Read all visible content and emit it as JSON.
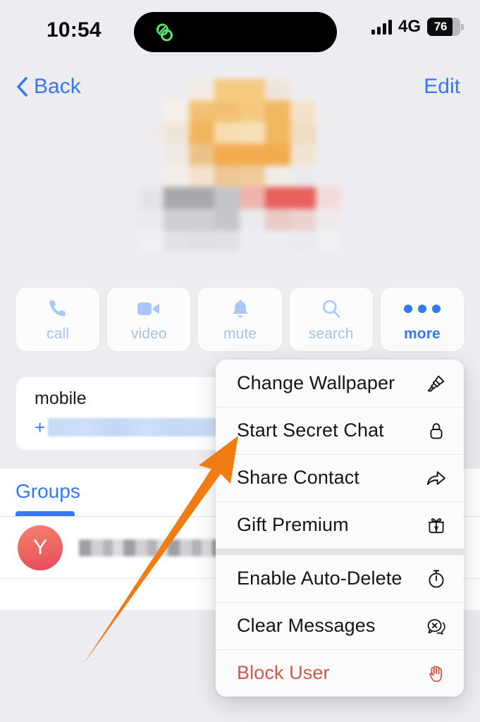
{
  "status_bar": {
    "time": "10:54",
    "island_icon": "link-chain-icon",
    "island_icon_color": "#5ee26e",
    "signal_icon": "cellular-signal-icon",
    "network_type": "4G",
    "battery_percent": "76",
    "battery_level": 76
  },
  "nav_bar": {
    "back_label": "Back",
    "back_icon": "chevron-left-icon",
    "edit_label": "Edit",
    "accent_color": "#3478f6"
  },
  "profile": {
    "avatar_state": "pixelated-censored"
  },
  "actions": [
    {
      "label": "call",
      "icon": "phone-icon",
      "state": "dim"
    },
    {
      "label": "video",
      "icon": "video-camera-icon",
      "state": "dim"
    },
    {
      "label": "mute",
      "icon": "bell-icon",
      "state": "dim"
    },
    {
      "label": "search",
      "icon": "magnifier-icon",
      "state": "dim"
    },
    {
      "label": "more",
      "icon": "ellipsis-icon",
      "state": "active"
    }
  ],
  "contact": {
    "label": "mobile",
    "value_prefix": "+",
    "value_state": "redacted"
  },
  "groups": {
    "tab_label": "Groups",
    "rows": [
      {
        "avatar_letter": "Y",
        "name_state": "redacted"
      }
    ]
  },
  "context_menu": {
    "groups": [
      {
        "items": [
          {
            "label": "Change Wallpaper",
            "icon": "paintbrush-icon",
            "destructive": false
          },
          {
            "label": "Start Secret Chat",
            "icon": "lock-icon",
            "destructive": false
          },
          {
            "label": "Share Contact",
            "icon": "share-arrow-icon",
            "destructive": false
          },
          {
            "label": "Gift Premium",
            "icon": "gift-box-icon",
            "destructive": false
          }
        ]
      },
      {
        "items": [
          {
            "label": "Enable Auto-Delete",
            "icon": "timer-icon",
            "destructive": false
          },
          {
            "label": "Clear Messages",
            "icon": "chat-bubble-x-icon",
            "destructive": false
          },
          {
            "label": "Block User",
            "icon": "stop-hand-icon",
            "destructive": true
          }
        ]
      }
    ],
    "destructive_color": "#d2584b"
  },
  "annotation": {
    "arrow_color": "#f07d13",
    "points_to": "Start Secret Chat"
  }
}
